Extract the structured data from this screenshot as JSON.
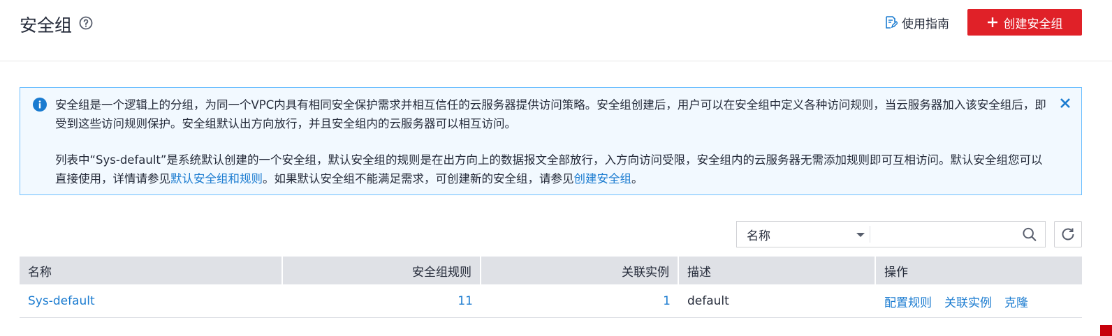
{
  "header": {
    "title": "安全组",
    "guide_label": "使用指南",
    "create_label": "创建安全组"
  },
  "alert": {
    "p1": "安全组是一个逻辑上的分组，为同一个VPC内具有相同安全保护需求并相互信任的云服务器提供访问策略。安全组创建后，用户可以在安全组中定义各种访问规则，当云服务器加入该安全组后，即受到这些访问规则保护。安全组默认出方向放行，并且安全组内的云服务器可以相互访问。",
    "p2_text1": "列表中“Sys-default”是系统默认创建的一个安全组，默认安全组的规则是在出方向上的数据报文全部放行，入方向访问受限，安全组内的云服务器无需添加规则即可互相访问。默认安全组您可以直接使用，详情请参见",
    "p2_link1": "默认安全组和规则",
    "p2_text2": "。如果默认安全组不能满足需求，可创建新的安全组，请参见",
    "p2_link2": "创建安全组",
    "p2_text3": "。"
  },
  "filter": {
    "selected": "名称",
    "placeholder": ""
  },
  "table": {
    "headers": [
      "名称",
      "安全组规则",
      "关联实例",
      "描述",
      "操作"
    ],
    "rows": [
      {
        "name": "Sys-default",
        "rules": "11",
        "instances": "1",
        "description": "default",
        "actions": [
          "配置规则",
          "关联实例",
          "克隆"
        ]
      }
    ]
  },
  "colors": {
    "primary_red": "#e02128",
    "link_blue": "#1a7bd0",
    "info_blue": "#1a7bd0",
    "alert_bg": "#f2f9ff",
    "alert_border": "#6cbfff",
    "table_header_bg": "#dfe1e6"
  },
  "icons": {
    "help": "question-circle-icon",
    "guide": "document-edit-icon",
    "create": "plus-icon",
    "info": "info-circle-icon",
    "close": "close-icon",
    "dropdown": "caret-down-icon",
    "search": "search-icon",
    "refresh": "refresh-icon"
  }
}
